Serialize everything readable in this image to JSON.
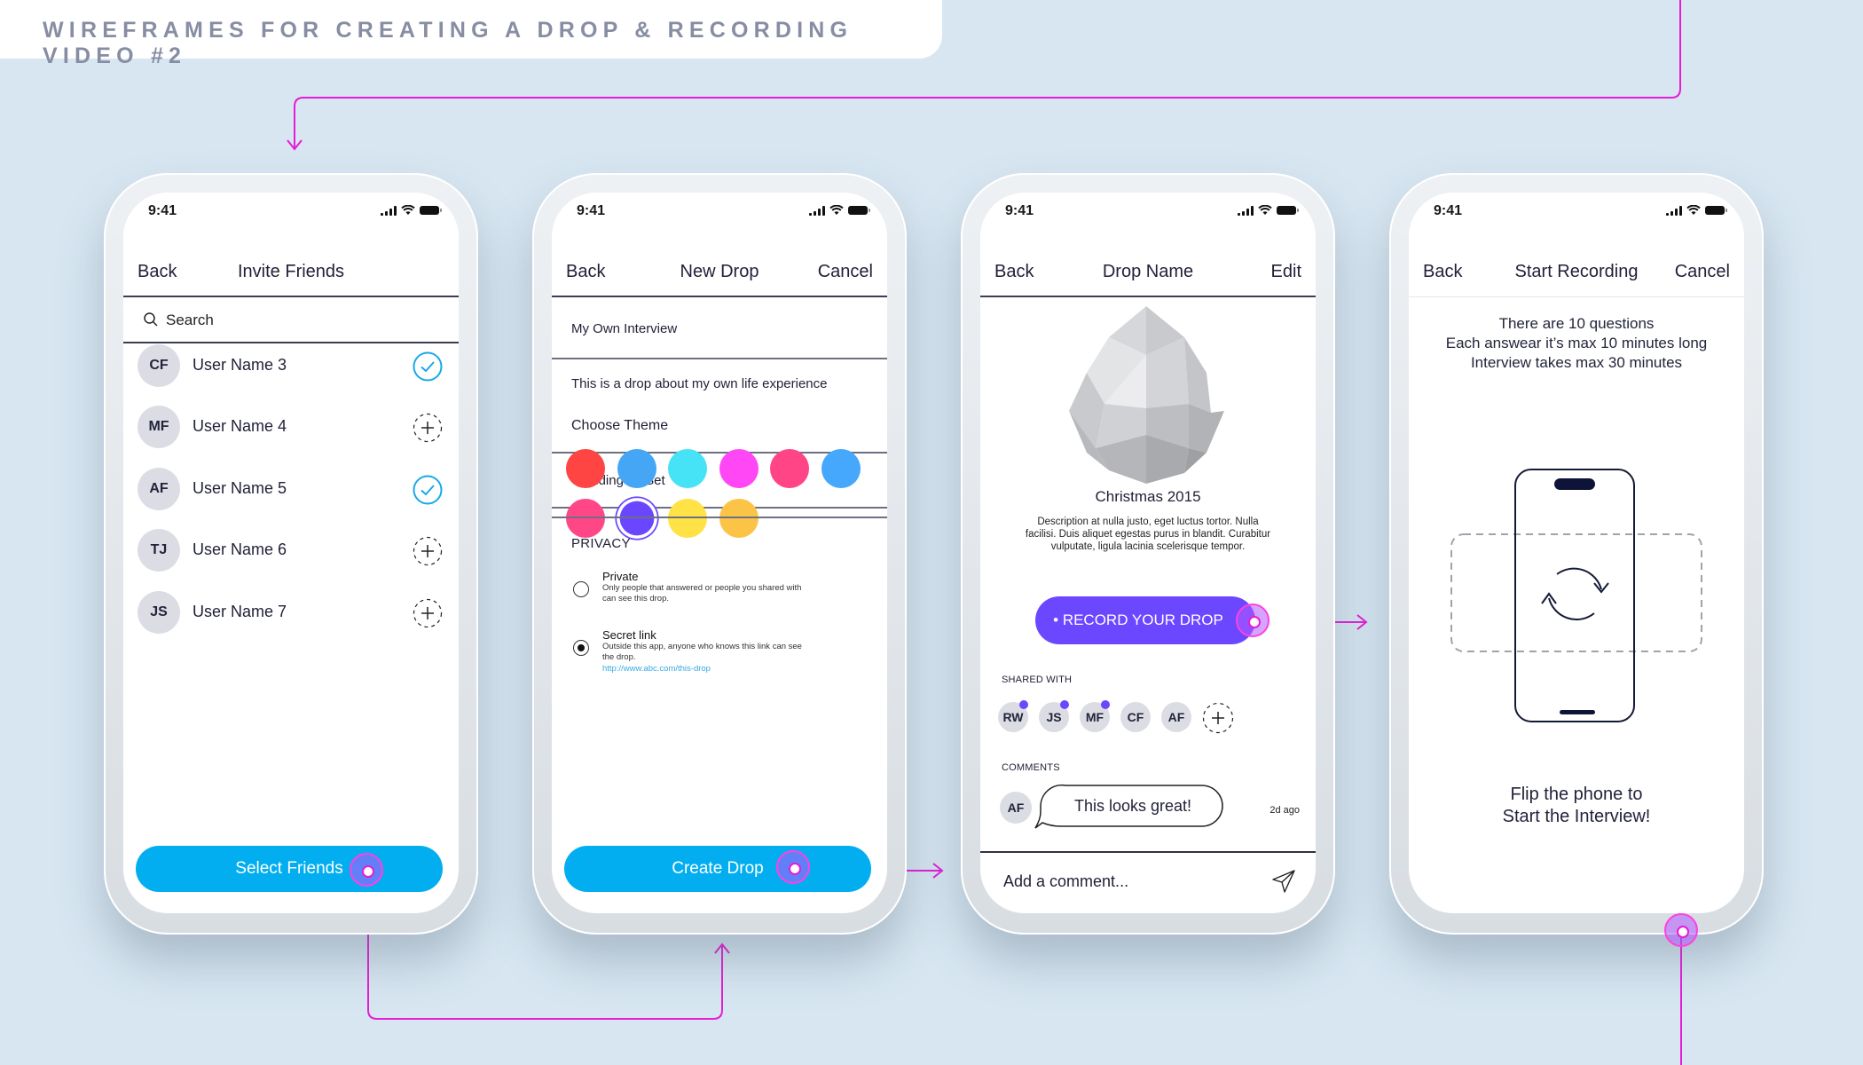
{
  "page_title": "WIREFRAMES FOR CREATING A DROP & RECORDING VIDEO #2",
  "accent_colors": {
    "primary_button": "#02aef0",
    "record_button": "#6b47ff",
    "flow_line": "#e61cd8"
  },
  "status_bar": {
    "time": "9:41",
    "icons": [
      "signal-icon",
      "wifi-icon",
      "battery-icon"
    ]
  },
  "screens": {
    "invite_friends": {
      "nav": {
        "back": "Back",
        "title": "Invite Friends"
      },
      "search": {
        "placeholder": "Search",
        "icon": "search-icon"
      },
      "users": [
        {
          "initials": "CF",
          "name": "User Name 3",
          "selected": true
        },
        {
          "initials": "MF",
          "name": "User Name 4",
          "selected": false
        },
        {
          "initials": "AF",
          "name": "User Name 5",
          "selected": true
        },
        {
          "initials": "TJ",
          "name": "User Name 6",
          "selected": false
        },
        {
          "initials": "JS",
          "name": "User Name 7",
          "selected": false
        }
      ],
      "primary_button": "Select Friends"
    },
    "new_drop": {
      "nav": {
        "back": "Back",
        "title": "New Drop",
        "right": "Cancel"
      },
      "name_value": "My Own Interview",
      "description_value": "This is a drop about my own life experience",
      "question_set_value": "Wedding Q. Set",
      "theme_label": "Choose Theme",
      "themes": [
        {
          "color": "#ff4444",
          "selected": false
        },
        {
          "color": "#44a6f5",
          "selected": false
        },
        {
          "color": "#45e3f5",
          "selected": false
        },
        {
          "color": "#ff47f5",
          "selected": false
        },
        {
          "color": "#ff4585",
          "selected": false
        },
        {
          "color": "#45a8fc",
          "selected": false
        },
        {
          "color": "#ff4787",
          "selected": false
        },
        {
          "color": "#6a47ff",
          "selected": true
        },
        {
          "color": "#ffe245",
          "selected": false
        },
        {
          "color": "#fcc447",
          "selected": false
        }
      ],
      "privacy_label": "PRIVACY",
      "privacy_options": [
        {
          "title": "Private",
          "description": "Only people that answered or people you shared with can see this drop.",
          "selected": false
        },
        {
          "title": "Secret link",
          "description": "Outside this app, anyone who knows this link can see the drop.",
          "link": "http://www.abc.com/this-drop",
          "selected": true
        }
      ],
      "primary_button": "Create Drop"
    },
    "drop_detail": {
      "nav": {
        "back": "Back",
        "title": "Drop Name",
        "right": "Edit"
      },
      "drop_title": "Christmas 2015",
      "drop_description": "Description at nulla justo, eget luctus tortor. Nulla facilisi. Duis aliquet egestas purus in blandit. Curabitur vulputate, ligula lacinia scelerisque tempor.",
      "record_button": "• RECORD YOUR DROP",
      "shared_label": "SHARED WITH",
      "shared_with": [
        {
          "initials": "RW",
          "notified": true
        },
        {
          "initials": "JS",
          "notified": true
        },
        {
          "initials": "MF",
          "notified": true
        },
        {
          "initials": "CF",
          "notified": false
        },
        {
          "initials": "AF",
          "notified": false
        }
      ],
      "comments_label": "COMMENTS",
      "comments": [
        {
          "initials": "AF",
          "text": "This looks great!",
          "time": "2d ago"
        }
      ],
      "comment_placeholder": "Add a comment..."
    },
    "start_recording": {
      "nav": {
        "back": "Back",
        "title": "Start Recording",
        "right": "Cancel"
      },
      "info_lines": [
        "There are 10 questions",
        "Each answear it’s max 10 minutes long",
        "Interview takes max 30 minutes"
      ],
      "flip_lines": [
        "Flip the phone to",
        "Start the Interview!"
      ]
    }
  }
}
